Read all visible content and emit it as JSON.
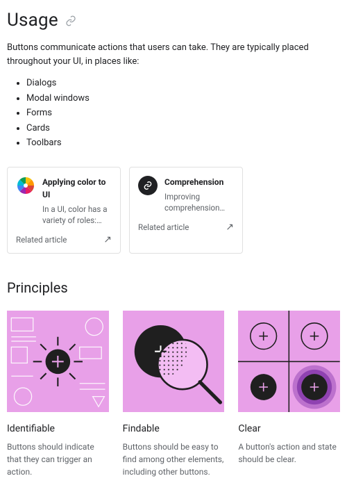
{
  "usage": {
    "title": "Usage",
    "intro": "Buttons communicate actions that users can take. They are typically placed throughout your UI, in places like:",
    "list": [
      "Dialogs",
      "Modal windows",
      "Forms",
      "Cards",
      "Toolbars"
    ]
  },
  "cards": [
    {
      "title": "Applying color to UI",
      "desc": "In a UI, color has a variety of roles:…",
      "footer": "Related article",
      "icon": "color-wheel-icon"
    },
    {
      "title": "Comprehension",
      "desc": "Improving comprehension…",
      "footer": "Related article",
      "icon": "link-chain-icon"
    }
  ],
  "principles": {
    "title": "Principles",
    "items": [
      {
        "title": "Identifiable",
        "desc": "Buttons should indicate that they can trigger an action."
      },
      {
        "title": "Findable",
        "desc": "Buttons should be easy to find among other elements, including other buttons."
      },
      {
        "title": "Clear",
        "desc": "A button's action and state should be clear."
      }
    ]
  }
}
